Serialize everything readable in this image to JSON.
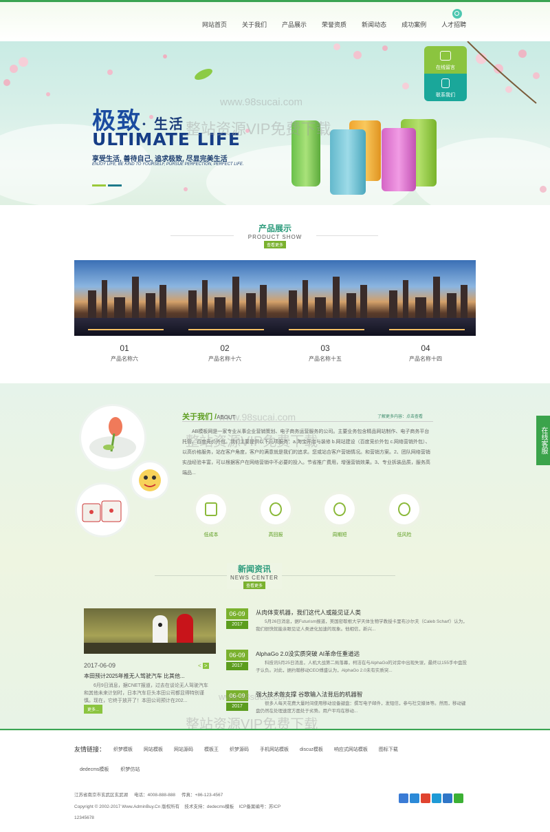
{
  "nav": {
    "items": [
      "网站首页",
      "关于我们",
      "产品展示",
      "荣誉资质",
      "新闻动态",
      "成功案例",
      "人才招聘"
    ]
  },
  "banner": {
    "headline_cn": "极致",
    "headline_cn2": "· 生活",
    "headline_en": "ULTIMATE LIFE",
    "slogan": "享受生活, 善待自己, 追求极致, 尽显完美生活",
    "slogan_en": "ENJOY LIFE, BE KIND TO YOURSELF, PURSUE PERFECTION, PERFECT LIFE.",
    "watermark_url": "www.98sucai.com",
    "watermark_text": "整站资源VIP免费下载"
  },
  "float_buttons": {
    "message": "在线留言",
    "contact": "联系我们"
  },
  "products": {
    "title_cn": "产品展示",
    "title_en": "PRODUCT SHOW",
    "more": "查看更多",
    "items": [
      {
        "num": "01",
        "name": "产品名称六"
      },
      {
        "num": "02",
        "name": "产品名称十六"
      },
      {
        "num": "03",
        "name": "产品名称十五"
      },
      {
        "num": "04",
        "name": "产品名称十四"
      }
    ]
  },
  "about": {
    "title_cn": "关于我们 /",
    "title_en": "ABOUT",
    "more": "了解更多内容：点击查看",
    "text": "AB模板网是一家专业从事企业营销策划、电子商务运营服务的公司。主要业务包含精品网站制作、电子商务平台托管、百度竞价外包。我们主要提供以下几项服务：a.淘宝开店与装修 b.网站建设（百度竞价外包 c.网络营销外包）、以高价格服务，站在客户角度，客户的满意就是我们的追求。您或站合客户营销情况。和营销方案。2、团队网络营销实战经验丰富，可以根据客户在网络营销中不必要的投入。节省推广费用，增强营销效果。3、专业拆装品质，服务高端品...",
    "features": [
      "低成本",
      "高回报",
      "周期短",
      "低风险"
    ],
    "side_tab": "在线客服"
  },
  "news": {
    "title_cn": "新闻资讯",
    "title_en": "NEWS CENTER",
    "more": "查看更多",
    "main": {
      "date": "2017-06-09",
      "title": "本田预计2025年推无人驾驶汽车 比其他...",
      "desc": "6月9日消息，据CNET报道，过去在谈论无人驾驶汽车和其他未来计划时，日本汽车巨头本田公司都显得特别谨慎。现在，它终于放开了！本田公司预计在202...",
      "more": "更多..."
    },
    "items": [
      {
        "day": "06-09",
        "year": "2017",
        "title": "从肉体变机器，我们这代人或能见证人类",
        "desc": "5月26日消息，据Futurism报道，美国密歇根大学天体生物学教授卡里布沙尔夫（Caleb Scharf）认为，我们很快就能亲眼见证人类进化加速的现象。他相信，新兴..."
      },
      {
        "day": "06-09",
        "year": "2017",
        "title": "AlphaGo 2.0没实质突破 AI革命任重道远",
        "desc": "科技讯5月25日消息，人机大战第二局落幕，柯洁在与AlphaGo的对弈中出现失误，最终以155手中盘投子认负。对此，据约翰移动CEO傅盛认为，AlphaGo 2.0未有实质突..."
      },
      {
        "day": "06-09",
        "year": "2017",
        "title": "强大技术做支撑 谷歌输入法背后的机器智",
        "desc": "很多人每天花费大量时间使用移动设备键盘：撰写电子邮件，发短信，参与社交媒体等。然而，移动键盘仍然在处理速度方面处于劣势。用户平均在移动..."
      }
    ]
  },
  "footer": {
    "friend_label": "友情链接：",
    "links": [
      "织梦模板",
      "网站模板",
      "网站源码",
      "模板王",
      "织梦源码",
      "手机网站模板",
      "discuz模板",
      "响应式网站模板",
      "图标下载"
    ],
    "links2": [
      "dedecms模板",
      "织梦仿站"
    ],
    "address": "江苏省南京市玄武区玄武湖",
    "phone": "电话：4008-888-888",
    "fax": "传真：+86-123-4567",
    "copyright": "Copyright © 2002-2017 Www.AdminBuy.Cn 版权所有",
    "tech": "技术支持：dedecms模板",
    "icp": "ICP备案编号：苏ICP",
    "icp2": "12345678"
  },
  "colors": {
    "brand_green": "#3aa452",
    "accent_green": "#7ab12e",
    "teal": "#1aa79a"
  }
}
